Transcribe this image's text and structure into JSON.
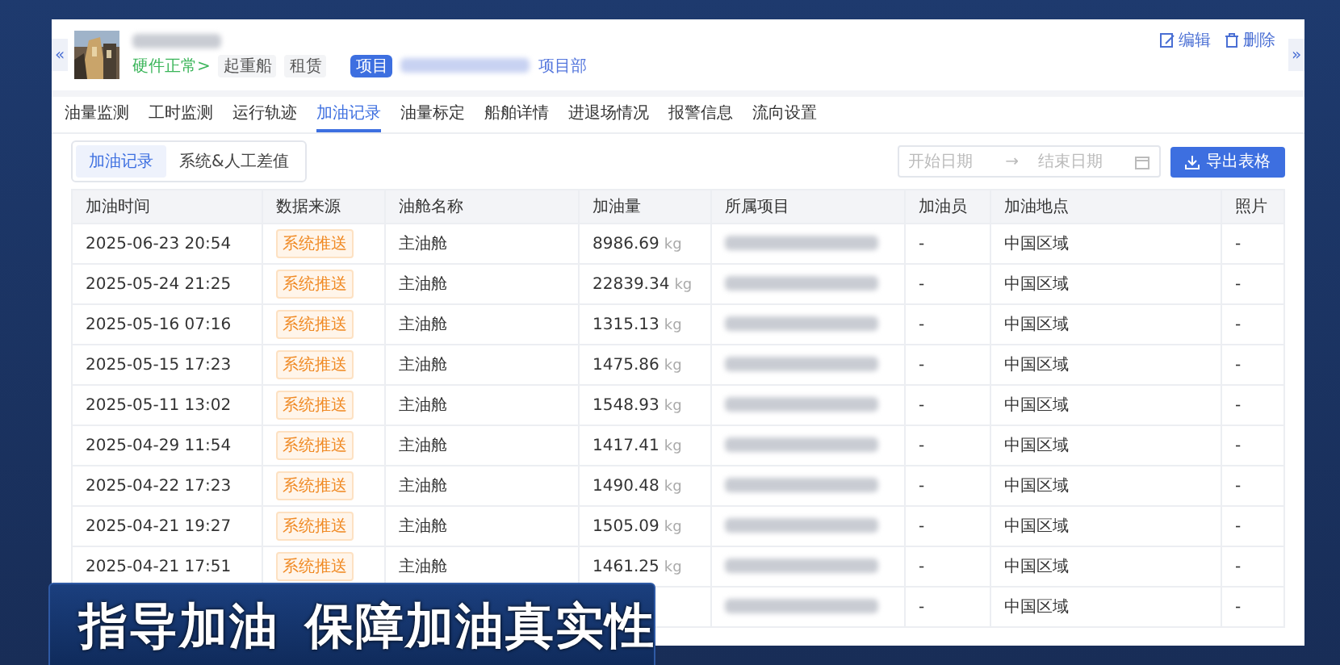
{
  "header": {
    "back": "«",
    "forward": "»",
    "status": "硬件正常>",
    "tags": [
      "起重船",
      "租赁"
    ],
    "project_badge": "项目",
    "project_name": "项目部",
    "actions": [
      {
        "kind": "edit",
        "label": "编辑"
      },
      {
        "kind": "delete",
        "label": "删除"
      }
    ]
  },
  "tabs": [
    {
      "label": "油量监测",
      "selected": false
    },
    {
      "label": "工时监测",
      "selected": false
    },
    {
      "label": "运行轨迹",
      "selected": false
    },
    {
      "label": "加油记录",
      "selected": true
    },
    {
      "label": "油量标定",
      "selected": false
    },
    {
      "label": "船舶详情",
      "selected": false
    },
    {
      "label": "进退场情况",
      "selected": false
    },
    {
      "label": "报警信息",
      "selected": false
    },
    {
      "label": "流向设置",
      "selected": false
    }
  ],
  "subtabs": [
    {
      "label": "加油记录",
      "selected": true
    },
    {
      "label": "系统&人工差值",
      "selected": false
    }
  ],
  "date_range": {
    "start_placeholder": "开始日期",
    "separator": "→",
    "end_placeholder": "结束日期"
  },
  "export_button": "导出表格",
  "table": {
    "columns": [
      "加油时间",
      "数据来源",
      "油舱名称",
      "加油量",
      "所属项目",
      "加油员",
      "加油地点",
      "照片"
    ],
    "rows": [
      {
        "time": "2025-06-23 20:54",
        "source": "系统推送",
        "tank": "主油舱",
        "amount": "8986.69",
        "unit": "kg",
        "refueler": "-",
        "location": "中国区域",
        "photo": "-"
      },
      {
        "time": "2025-05-24 21:25",
        "source": "系统推送",
        "tank": "主油舱",
        "amount": "22839.34",
        "unit": "kg",
        "refueler": "-",
        "location": "中国区域",
        "photo": "-"
      },
      {
        "time": "2025-05-16 07:16",
        "source": "系统推送",
        "tank": "主油舱",
        "amount": "1315.13",
        "unit": "kg",
        "refueler": "-",
        "location": "中国区域",
        "photo": "-"
      },
      {
        "time": "2025-05-15 17:23",
        "source": "系统推送",
        "tank": "主油舱",
        "amount": "1475.86",
        "unit": "kg",
        "refueler": "-",
        "location": "中国区域",
        "photo": "-"
      },
      {
        "time": "2025-05-11 13:02",
        "source": "系统推送",
        "tank": "主油舱",
        "amount": "1548.93",
        "unit": "kg",
        "refueler": "-",
        "location": "中国区域",
        "photo": "-"
      },
      {
        "time": "2025-04-29 11:54",
        "source": "系统推送",
        "tank": "主油舱",
        "amount": "1417.41",
        "unit": "kg",
        "refueler": "-",
        "location": "中国区域",
        "photo": "-"
      },
      {
        "time": "2025-04-22 17:23",
        "source": "系统推送",
        "tank": "主油舱",
        "amount": "1490.48",
        "unit": "kg",
        "refueler": "-",
        "location": "中国区域",
        "photo": "-"
      },
      {
        "time": "2025-04-21 19:27",
        "source": "系统推送",
        "tank": "主油舱",
        "amount": "1505.09",
        "unit": "kg",
        "refueler": "-",
        "location": "中国区域",
        "photo": "-"
      },
      {
        "time": "2025-04-21 17:51",
        "source": "系统推送",
        "tank": "主油舱",
        "amount": "1461.25",
        "unit": "kg",
        "refueler": "-",
        "location": "中国区域",
        "photo": "-"
      },
      {
        "refueler": "-",
        "location": "中国区域",
        "photo": "-"
      }
    ]
  },
  "caption": [
    "指导加油",
    "保障加油真实性"
  ]
}
